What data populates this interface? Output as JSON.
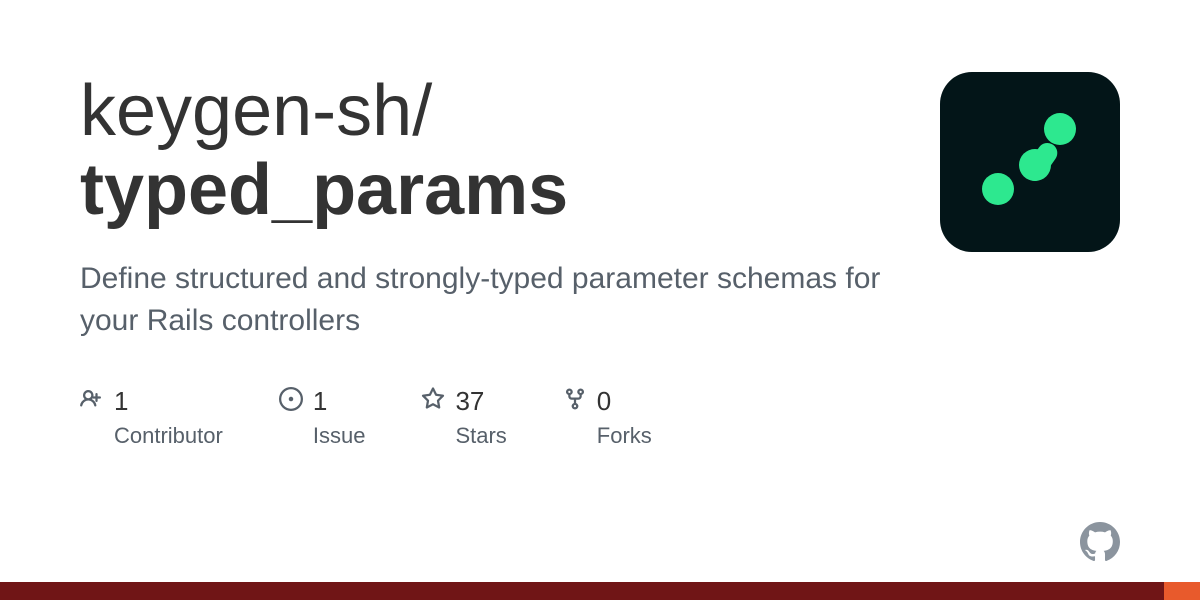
{
  "owner": "keygen-sh",
  "separator": "/",
  "repo": "typed_params",
  "description": "Define structured and strongly-typed parameter schemas for your Rails controllers",
  "stats": {
    "contributors": {
      "value": "1",
      "label": "Contributor"
    },
    "issues": {
      "value": "1",
      "label": "Issue"
    },
    "stars": {
      "value": "37",
      "label": "Stars"
    },
    "forks": {
      "value": "0",
      "label": "Forks"
    }
  },
  "colors": {
    "bar_main_pct": "97",
    "bar_accent_pct": "3"
  }
}
